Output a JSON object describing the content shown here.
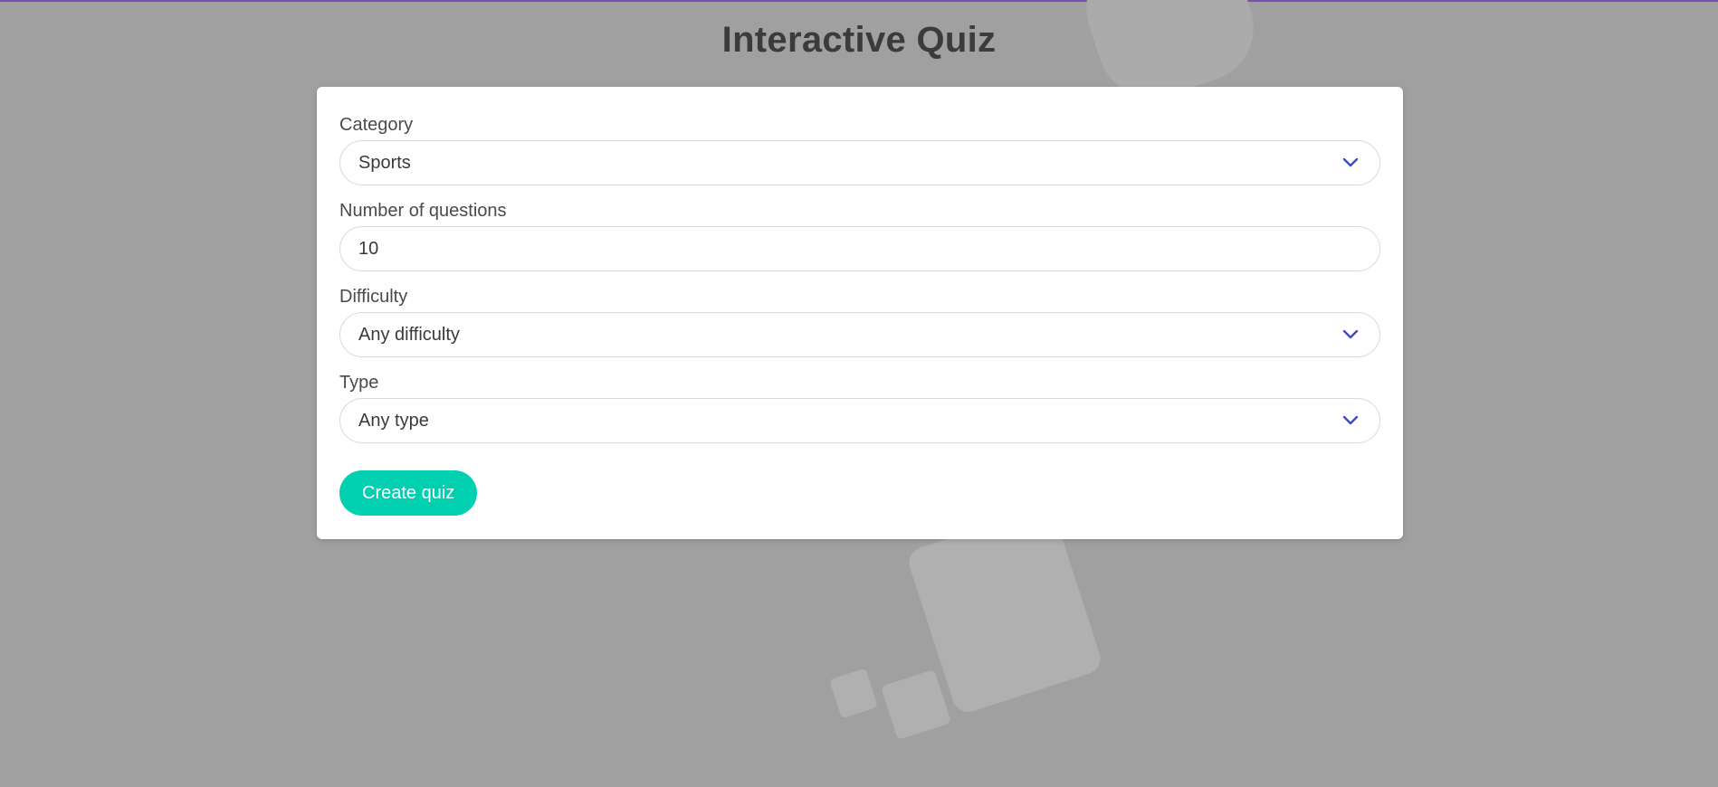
{
  "page": {
    "title": "Interactive Quiz"
  },
  "form": {
    "category": {
      "label": "Category",
      "value": "Sports"
    },
    "num_questions": {
      "label": "Number of questions",
      "value": "10"
    },
    "difficulty": {
      "label": "Difficulty",
      "value": "Any difficulty"
    },
    "type": {
      "label": "Type",
      "value": "Any type"
    },
    "submit_label": "Create quiz"
  },
  "icons": {
    "select_arrow": "chevron-down-icon"
  },
  "colors": {
    "accent": "#00cfb0",
    "chevron": "#3b4cc0",
    "background": "#a0a0a0",
    "top_border": "#7a4fb4"
  }
}
